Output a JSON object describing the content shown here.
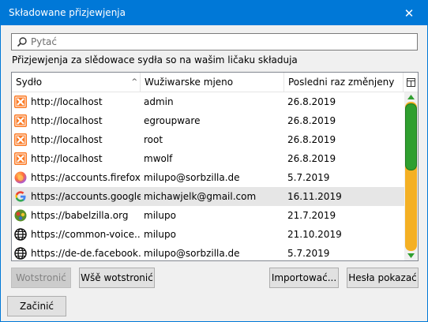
{
  "window": {
    "title": "Składowane přizjewjenja",
    "close_glyph": "✕"
  },
  "search": {
    "placeholder": "Pytać",
    "value": ""
  },
  "description": "Přizjewjenja za slědowace sydła so na wašim ličaku składuja",
  "columns": {
    "site": "Sydło",
    "username": "Wužiwarske mjeno",
    "changed": "Posledni raz změnjeny"
  },
  "rows": [
    {
      "site": "http://localhost",
      "user": "admin",
      "date": "26.8.2019",
      "icon": "xampp-icon"
    },
    {
      "site": "http://localhost",
      "user": "egroupware",
      "date": "26.8.2019",
      "icon": "xampp-icon"
    },
    {
      "site": "http://localhost",
      "user": "root",
      "date": "26.8.2019",
      "icon": "xampp-icon"
    },
    {
      "site": "http://localhost",
      "user": "mwolf",
      "date": "26.8.2019",
      "icon": "xampp-icon"
    },
    {
      "site": "https://accounts.firefox....",
      "user": "milupo@sorbzilla.de",
      "date": "5.7.2019",
      "icon": "firefox-icon"
    },
    {
      "site": "https://accounts.google....",
      "user": "michawjelk@gmail.com",
      "date": "16.11.2019",
      "icon": "google-icon",
      "selected": true
    },
    {
      "site": "https://babelzilla.org",
      "user": "milupo",
      "date": "21.7.2019",
      "icon": "babelzilla-icon"
    },
    {
      "site": "https://common-voice....",
      "user": "milupo",
      "date": "21.10.2019",
      "icon": "globe-icon"
    },
    {
      "site": "https://de-de.facebook....",
      "user": "milupo@sorbzilla.de",
      "date": "5.7.2019",
      "icon": "globe-icon"
    }
  ],
  "scrollbar": {
    "position_fraction": 0.0,
    "visible_fraction": 0.45
  },
  "buttons": {
    "remove": "Wotstronić",
    "remove_all": "Wšě wotstronić",
    "import": "Importować...",
    "show_passwords": "Hesła pokazać",
    "close": "Začinić"
  },
  "colors": {
    "titlebar": "#0078d7",
    "scroll_track": "#f4b024",
    "scroll_thumb": "#2f9f2f",
    "selected_row": "#e6e6e6"
  }
}
